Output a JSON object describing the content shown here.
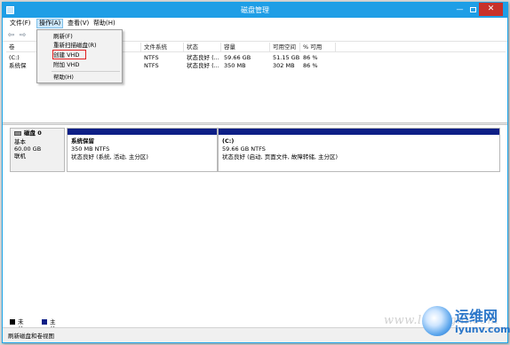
{
  "window": {
    "title": "磁盘管理",
    "close_symbol": "✕",
    "minimize_symbol": "—"
  },
  "menubar": {
    "items": [
      "文件(F)",
      "操作(A)",
      "查看(V)",
      "帮助(H)"
    ]
  },
  "toolbar": {
    "back_icon": "back-arrow-icon",
    "forward_icon": "forward-arrow-icon",
    "back_glyph": "⇦",
    "forward_glyph": "⇨"
  },
  "dropdown": {
    "items": [
      "刷新(F)",
      "重新扫描磁盘(R)",
      "创建 VHD",
      "附加 VHD",
      "帮助(H)"
    ],
    "highlighted_item": "创建 VHD",
    "highlight_color": "#e02020"
  },
  "volume_table": {
    "columns": [
      "卷",
      "",
      "",
      "文件系统",
      "状态",
      "容量",
      "可用空间",
      "% 可用"
    ],
    "rows": [
      [
        "(C:)",
        "",
        "",
        "NTFS",
        "状态良好 (...",
        "59.66 GB",
        "51.15 GB",
        "86 %"
      ],
      [
        "系统保",
        "",
        "",
        "NTFS",
        "状态良好 (...",
        "350 MB",
        "302 MB",
        "86 %"
      ]
    ]
  },
  "disk": {
    "name": "磁盘 0",
    "type": "基本",
    "size": "60.00 GB",
    "status": "联机",
    "partitions": [
      {
        "name": "系统保留",
        "size": "350 MB NTFS",
        "status": "状态良好 (系统, 活动, 主分区)"
      },
      {
        "name": "(C:)",
        "size": "59.66 GB NTFS",
        "status": "状态良好 (启动, 页面文件, 故障转储, 主分区)"
      }
    ],
    "bar_color": "#0d1f86"
  },
  "legend": [
    {
      "label": "未分配",
      "color": "#000000"
    },
    {
      "label": "主分区",
      "color": "#0d1f86"
    }
  ],
  "statusbar": {
    "text": "刷新磁盘和卷视图"
  },
  "watermark": {
    "url": "www.lidongni.com",
    "cn_text": "运维网",
    "domain_text": "iyunv.com"
  },
  "colors": {
    "titlebar": "#1e9ee6",
    "close_button": "#c7312a",
    "menu_active": "#cde8fb"
  }
}
